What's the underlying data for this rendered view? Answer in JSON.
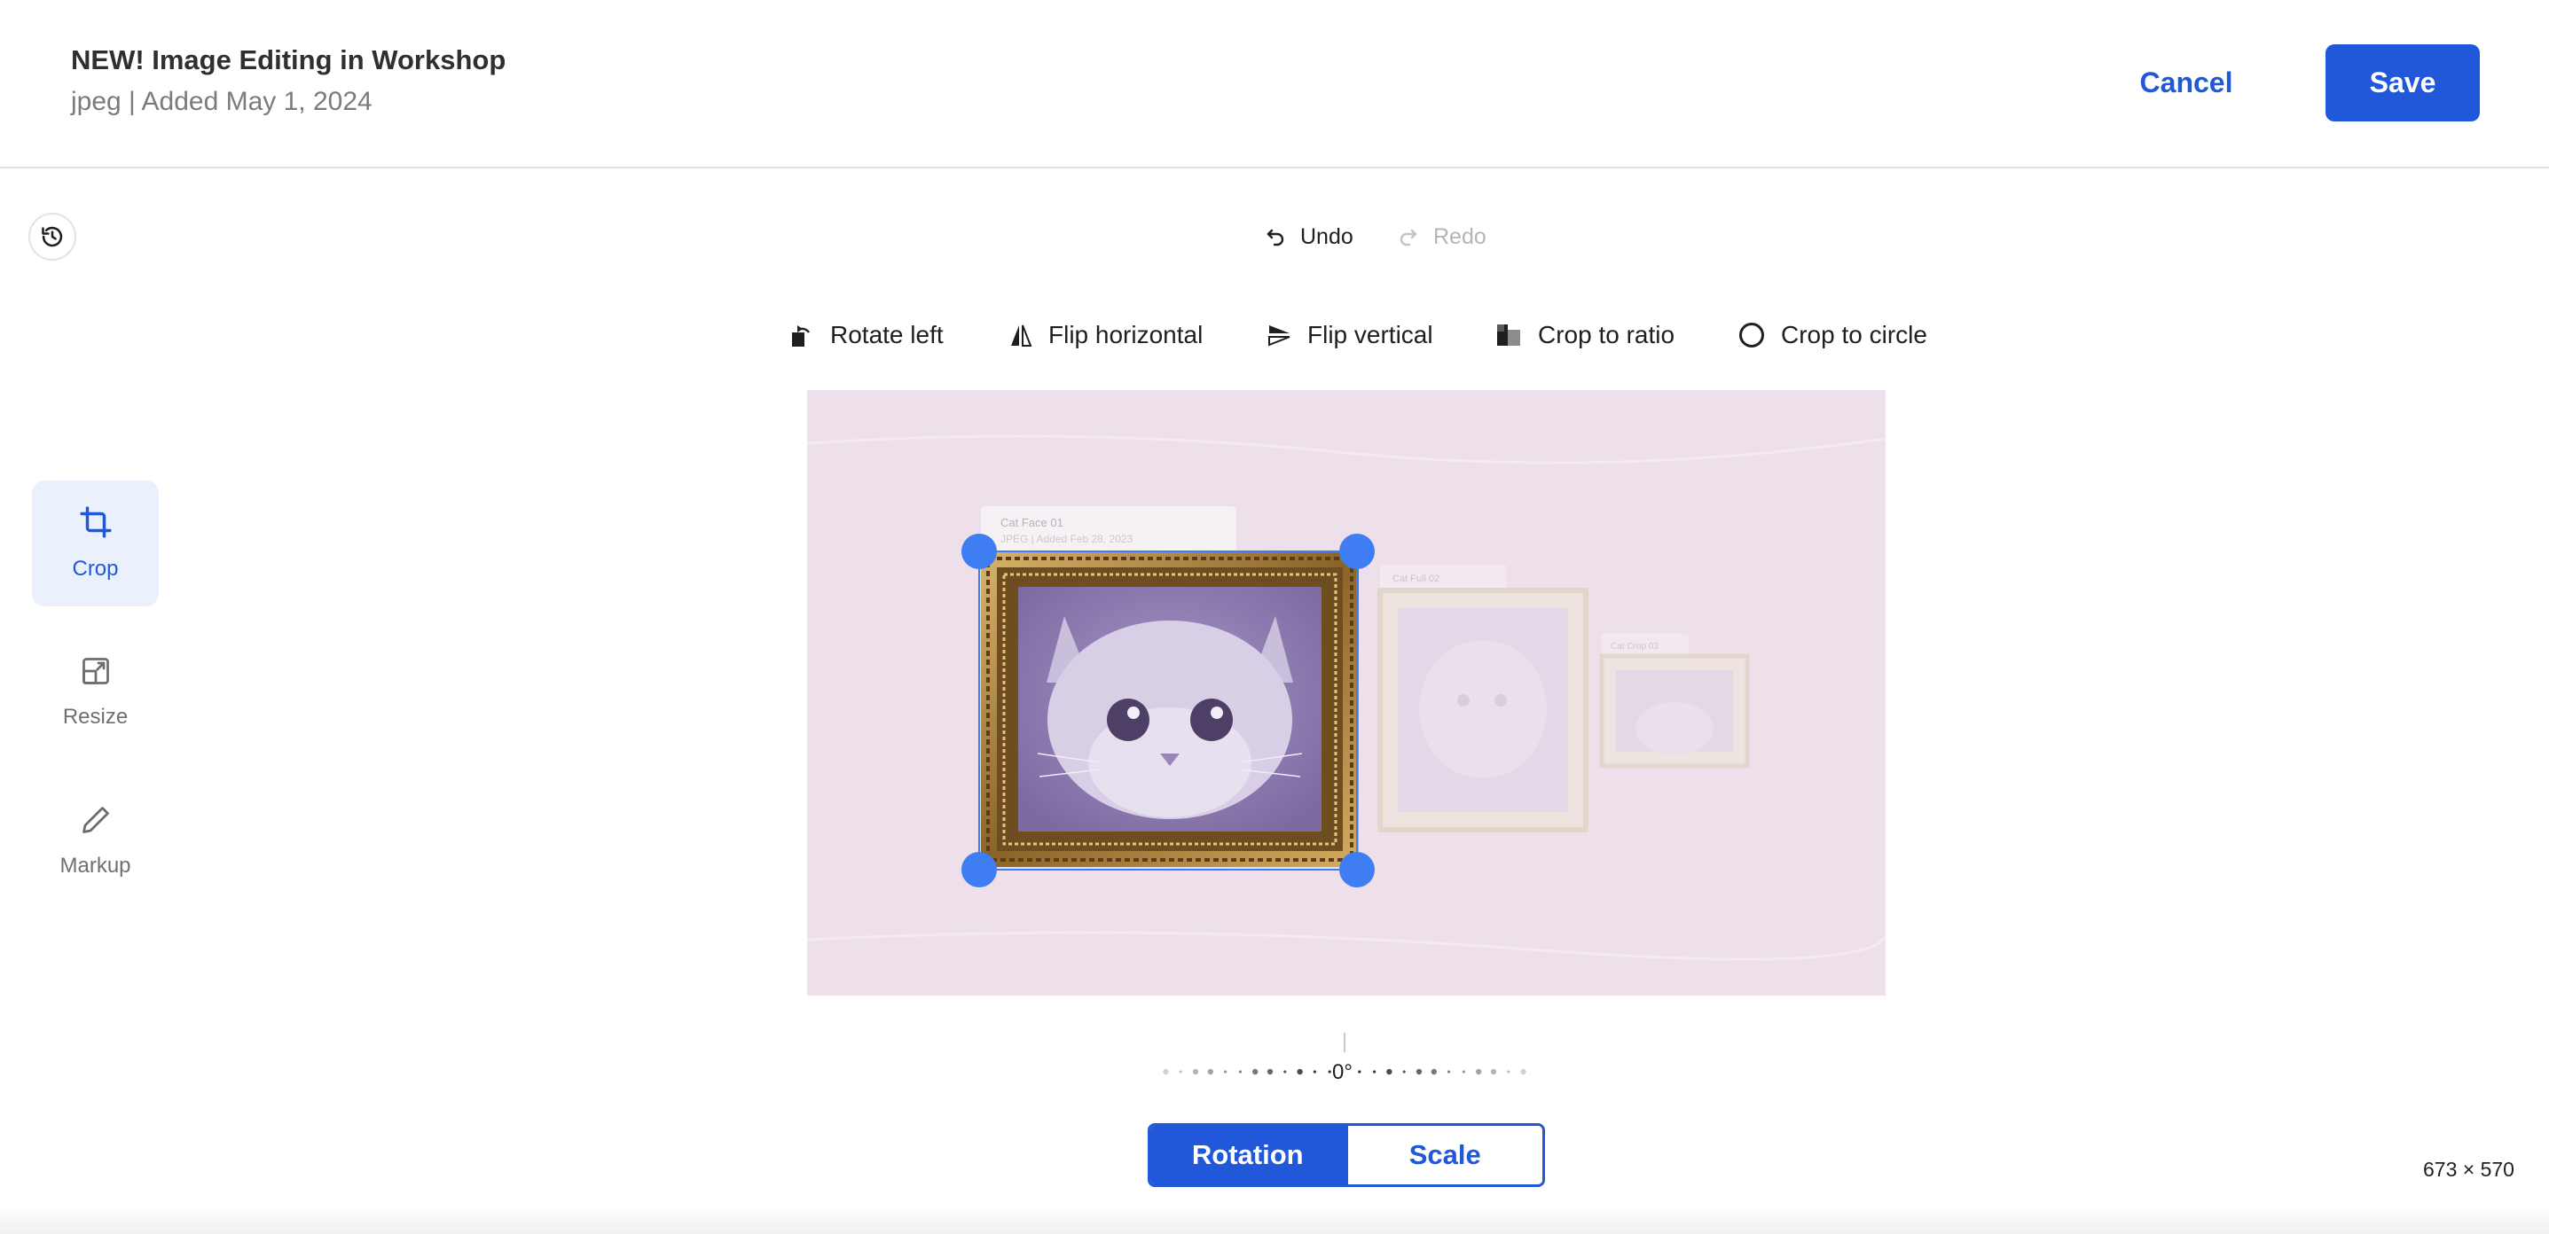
{
  "header": {
    "title": "NEW! Image Editing in Workshop",
    "subtitle": "jpeg | Added May 1, 2024",
    "cancel_label": "Cancel",
    "save_label": "Save"
  },
  "history": {
    "undo_label": "Undo",
    "redo_label": "Redo"
  },
  "toolbar": [
    {
      "label": "Rotate left",
      "icon": "rotate-left-icon"
    },
    {
      "label": "Flip horizontal",
      "icon": "flip-horizontal-icon"
    },
    {
      "label": "Flip vertical",
      "icon": "flip-vertical-icon"
    },
    {
      "label": "Crop to ratio",
      "icon": "crop-ratio-icon"
    },
    {
      "label": "Crop to circle",
      "icon": "crop-circle-icon"
    }
  ],
  "sidebar": {
    "items": [
      {
        "label": "Crop",
        "icon": "crop-icon",
        "active": true
      },
      {
        "label": "Resize",
        "icon": "resize-icon",
        "active": false
      },
      {
        "label": "Markup",
        "icon": "pencil-icon",
        "active": false
      }
    ]
  },
  "canvas": {
    "cards": [
      {
        "title": "Cat Face 01",
        "subtitle": "JPEG | Added Feb 28, 2023"
      },
      {
        "title": "Cat Full 02"
      },
      {
        "title": "Cat Crop 03"
      }
    ]
  },
  "rotation": {
    "value": "0°"
  },
  "mode_toggle": {
    "rotation_label": "Rotation",
    "scale_label": "Scale",
    "selected": "Rotation"
  },
  "dimensions": "673 × 570",
  "colors": {
    "accent": "#2157d9",
    "handle": "#3f7ef2",
    "canvas_bg": "#ede0ea"
  }
}
